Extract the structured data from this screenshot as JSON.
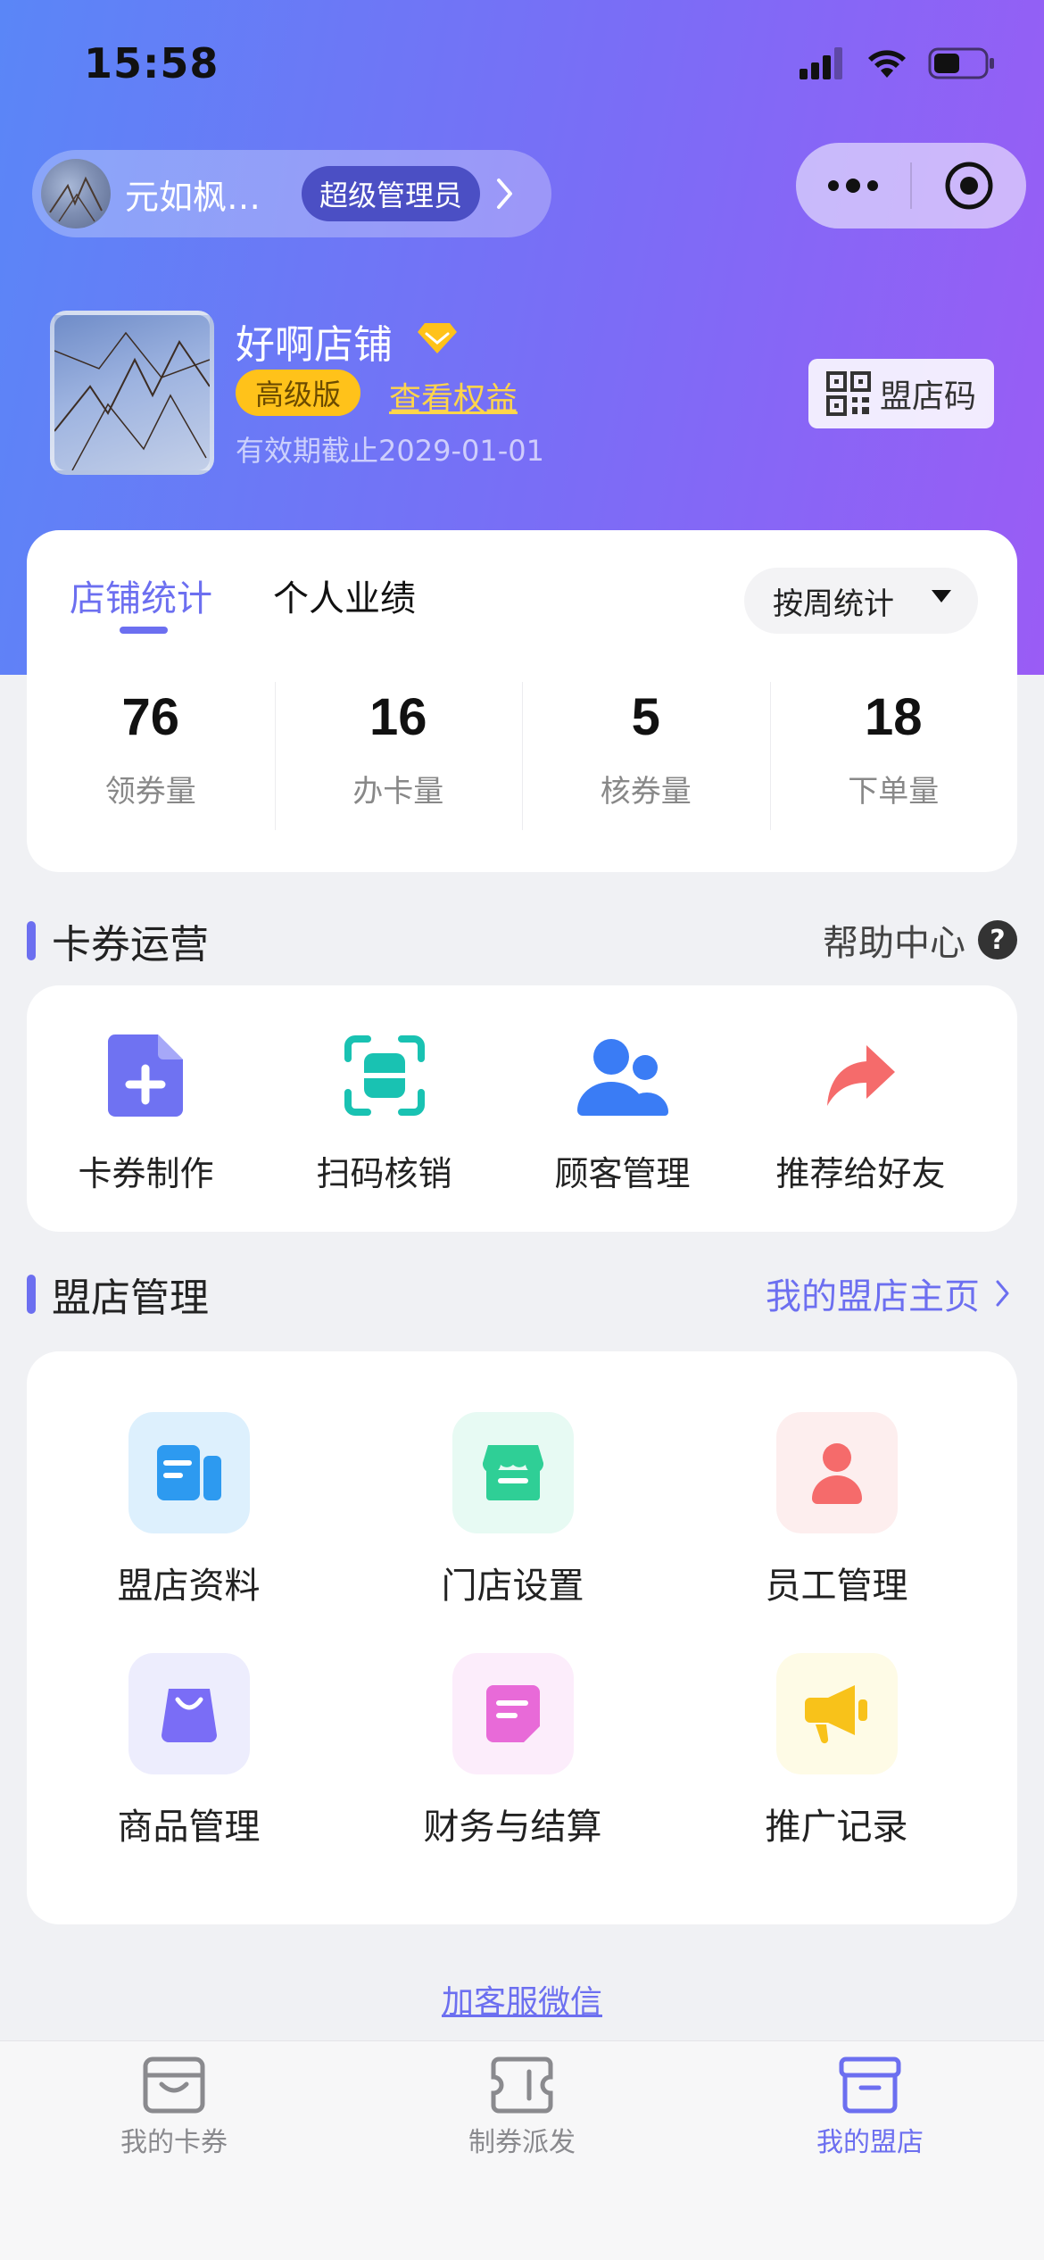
{
  "status_bar": {
    "time": "15:58"
  },
  "user": {
    "name": "元如枫…",
    "role": "超级管理员"
  },
  "store": {
    "name": "好啊店铺",
    "level": "高级版",
    "rights_link": "查看权益",
    "valid_until": "有效期截止2029-01-01",
    "qr_label": "盟店码"
  },
  "stats": {
    "tabs": [
      "店铺统计",
      "个人业绩"
    ],
    "period": "按周统计",
    "items": [
      {
        "value": "76",
        "label": "领券量"
      },
      {
        "value": "16",
        "label": "办卡量"
      },
      {
        "value": "5",
        "label": "核券量"
      },
      {
        "value": "18",
        "label": "下单量"
      }
    ]
  },
  "card_ops": {
    "title": "卡券运营",
    "help": "帮助中心",
    "help_icon_glyph": "?",
    "items": [
      {
        "label": "卡券制作",
        "icon": "add-document-icon",
        "color": "#6f72f2"
      },
      {
        "label": "扫码核销",
        "icon": "scan-icon",
        "color": "#19c2b2"
      },
      {
        "label": "顾客管理",
        "icon": "customers-icon",
        "color": "#3a7cf5"
      },
      {
        "label": "推荐给好友",
        "icon": "share-arrow-icon",
        "color": "#f56b6b"
      }
    ]
  },
  "store_mgmt": {
    "title": "盟店管理",
    "home_link": "我的盟店主页",
    "items": [
      {
        "label": "盟店资料",
        "icon": "store-profile-icon",
        "color": "#2d9af0"
      },
      {
        "label": "门店设置",
        "icon": "storefront-icon",
        "color": "#2fcf96"
      },
      {
        "label": "员工管理",
        "icon": "staff-icon",
        "color": "#f56b6b"
      },
      {
        "label": "商品管理",
        "icon": "shopping-bag-icon",
        "color": "#7a6df6"
      },
      {
        "label": "财务与结算",
        "icon": "finance-icon",
        "color": "#e86ad8"
      },
      {
        "label": "推广记录",
        "icon": "megaphone-icon",
        "color": "#f8c21a"
      }
    ]
  },
  "kefu_link": "加客服微信",
  "tabbar": [
    {
      "label": "我的卡券",
      "icon": "card-wallet-icon"
    },
    {
      "label": "制券派发",
      "icon": "coupon-icon"
    },
    {
      "label": "我的盟店",
      "icon": "my-store-icon",
      "active": true
    }
  ]
}
